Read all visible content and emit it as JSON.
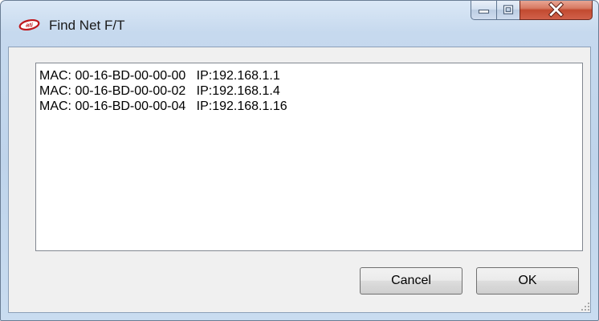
{
  "window": {
    "title": "Find Net F/T",
    "icon": "ati-logo-icon",
    "caption_buttons": [
      "minimize-icon",
      "maximize-icon",
      "close-icon"
    ]
  },
  "list": {
    "items": [
      {
        "mac": "MAC: 00-16-BD-00-00-00",
        "ip": "IP:192.168.1.1"
      },
      {
        "mac": "MAC: 00-16-BD-00-00-02",
        "ip": "IP:192.168.1.4"
      },
      {
        "mac": "MAC: 00-16-BD-00-00-04",
        "ip": "IP:192.168.1.16"
      }
    ]
  },
  "buttons": {
    "cancel_label": "Cancel",
    "ok_label": "OK"
  },
  "colors": {
    "frame": "#c6d9ee",
    "client": "#f0f0f0",
    "close_button": "#c24a30"
  }
}
